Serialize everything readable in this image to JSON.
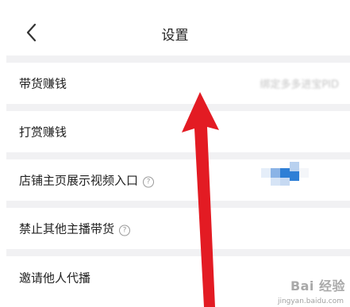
{
  "header": {
    "title": "设置",
    "back_icon": "chevron-left-icon"
  },
  "rows": [
    {
      "label": "带货赚钱",
      "value": "绑定多多进宝PID"
    },
    {
      "label": "打赏赚钱"
    },
    {
      "label": "店铺主页展示视频入口",
      "help": "?"
    },
    {
      "label": "禁止其他主播带货",
      "help": "?"
    },
    {
      "label": "邀请他人代播"
    }
  ],
  "watermark": {
    "text": "Bai 经验",
    "sub": "jingyan.baidu.com"
  },
  "colors": {
    "arrow": "#e31b23",
    "toggle_blue": "#2f7fd6",
    "divider": "#f1f1f3"
  }
}
